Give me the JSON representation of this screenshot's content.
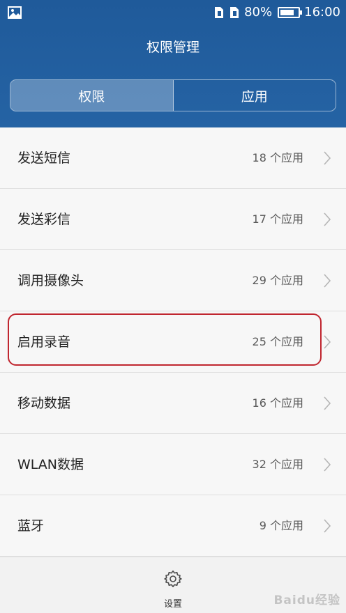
{
  "status_bar": {
    "battery_text": "80%",
    "battery_level": 0.8,
    "time": "16:00"
  },
  "header": {
    "title": "权限管理",
    "tabs": [
      {
        "label": "权限",
        "active": true
      },
      {
        "label": "应用",
        "active": false
      }
    ]
  },
  "permissions": [
    {
      "label": "发送短信",
      "count": "18 个应用"
    },
    {
      "label": "发送彩信",
      "count": "17 个应用"
    },
    {
      "label": "调用摄像头",
      "count": "29 个应用"
    },
    {
      "label": "启用录音",
      "count": "25 个应用"
    },
    {
      "label": "移动数据",
      "count": "16 个应用"
    },
    {
      "label": "WLAN数据",
      "count": "32 个应用"
    },
    {
      "label": "蓝牙",
      "count": "9 个应用"
    }
  ],
  "bottom_bar": {
    "settings_label": "设置",
    "icon": "gear-icon"
  },
  "watermark": "Baidu经验",
  "colors": {
    "header_blue": "#2563a4",
    "highlight_red": "#c0262f"
  }
}
